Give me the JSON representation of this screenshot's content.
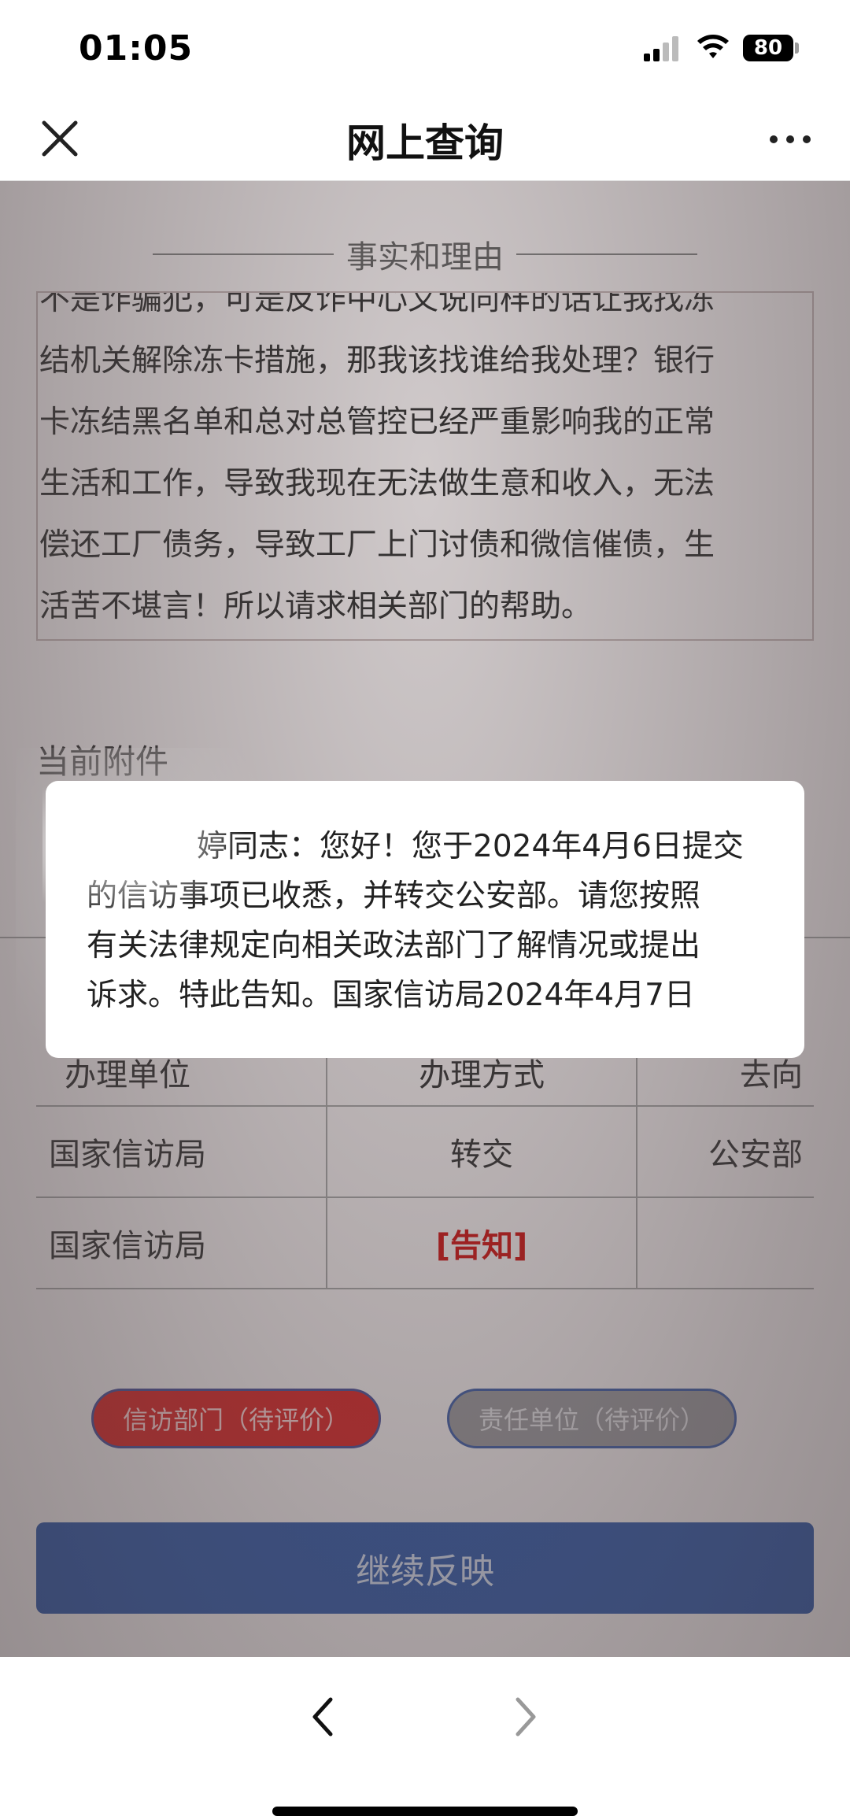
{
  "status_bar": {
    "time": "01:05",
    "battery": "80"
  },
  "nav": {
    "title": "网上查询"
  },
  "facts": {
    "heading": "事实和理由",
    "lines": [
      "不是诈骗犯，可是反诈中心又说同样的话让我找冻",
      "结机关解除冻卡措施，那我该找谁给我处理？银行",
      "卡冻结黑名单和总对总管控已经严重影响我的正常",
      "生活和工作，导致我现在无法做生意和收入，无法",
      "偿还工厂债务，导致工厂上门讨债和微信催债，生",
      "活苦不堪言！所以请求相关部门的帮助。"
    ]
  },
  "attachments": {
    "label": "当前附件"
  },
  "table": {
    "headers": [
      "办理单位",
      "办理方式",
      "去向"
    ],
    "rows": [
      {
        "unit": "国家信访局",
        "method": "转交",
        "destination": "公安部"
      },
      {
        "unit": "国家信访局",
        "method": "[告知]",
        "destination": ""
      }
    ]
  },
  "buttons": {
    "eval_petition": "信访部门（待评价）",
    "eval_responsible": "责任单位（待评价）",
    "continue": "继续反映"
  },
  "modal": {
    "lines": [
      "婷同志：您好！您于2024年4月6日提交",
      "的信访事项已收悉，并转交公安部。请您按照",
      "有关法律规定向相关政法部门了解情况或提出",
      "诉求。特此告知。国家信访局2024年4月7日"
    ]
  },
  "colors": {
    "accent_blue": "#1f4a9e",
    "accent_red": "#d11313",
    "link_red": "#c40000"
  }
}
